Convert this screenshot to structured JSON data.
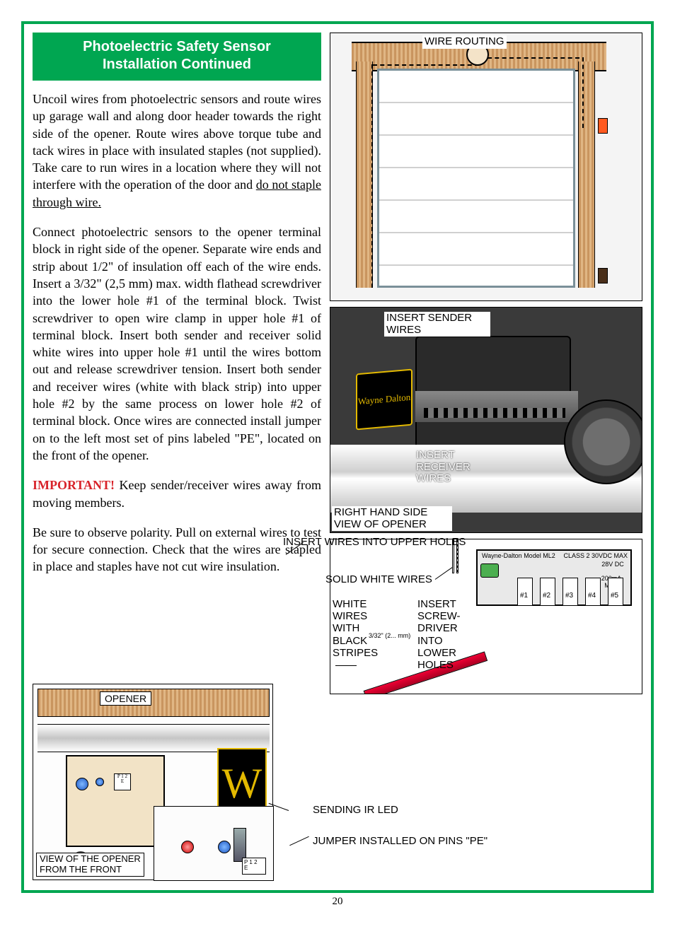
{
  "header": {
    "title_line1": "Photoelectric Safety Sensor",
    "title_line2": "Installation Continued"
  },
  "paragraphs": {
    "p1_a": "Uncoil wires from photoelectric sensors and route wires up garage wall and along door header towards the right side of the opener. Route wires above torque tube and tack wires in place with insulated staples (not supplied). Take care to run wires in a location where they will not interfere with the operation of the door and ",
    "p1_u": "do not staple through wire.",
    "p2": "Connect photoelectric sensors to the opener terminal block in right side of the opener. Separate wire ends and strip about 1/2\" of insulation off each of the wire ends. Insert a 3/32\" (2,5 mm) max. width flathead screwdriver into the lower hole #1 of the terminal block. Twist screwdriver to open wire clamp in upper hole #1 of terminal block. Insert both sender and receiver solid white wires into upper hole #1 until the wires bottom out and release screwdriver tension. Insert both sender and receiver wires (white with black strip) into upper hole #2 by the same process on lower hole #2 of terminal block. Once wires are connected install jumper on to the left most set of pins labeled \"PE\", located on the front of  the opener.",
    "p3_important": "IMPORTANT!",
    "p3_rest": "  Keep sender/receiver wires away from moving members.",
    "p4": "Be sure to observe polarity. Pull on external wires to test for secure connection. Check that the wires are stapled in place and staples have not cut wire insulation."
  },
  "diagram1": {
    "wire_routing": "WIRE ROUTING"
  },
  "diagram2": {
    "insert_sender": "INSERT SENDER WIRES",
    "insert_receiver": "INSERT RECEIVER WIRES",
    "view_label": "RIGHT HAND SIDE VIEW OF OPENER",
    "brand": "Wayne Dalton"
  },
  "diagram3": {
    "header_text": "Wayne-Dalton Model ML2",
    "class_text": "CLASS 2 30VDC MAX",
    "volts": "28V DC",
    "amps": "200mA MAX",
    "pin1": "#1",
    "pin2": "#2",
    "pin3": "#3",
    "pin4": "#4",
    "pin5": "#5",
    "screwdriver_note": "3/32\" (2... mm)"
  },
  "labels": {
    "insert_upper": "INSERT WIRES INTO UPPER HOLES",
    "solid_white": "SOLID WHITE WIRES",
    "white_stripes": "WHITE WIRES WITH BLACK STRIPES",
    "insert_screwdriver": "INSERT SCREW-DRIVER INTO LOWER HOLES",
    "sending_led": "SENDING IR LED",
    "jumper_pe": "JUMPER INSTALLED ON PINS \"PE\""
  },
  "diagram4": {
    "opener": "OPENER",
    "front_view_l1": "VIEW OF THE OPENER",
    "front_view_l2": "FROM THE FRONT",
    "jumper_box": "P 1 2\nE",
    "stamp": "P 1 2\nE"
  },
  "page_number": "20"
}
